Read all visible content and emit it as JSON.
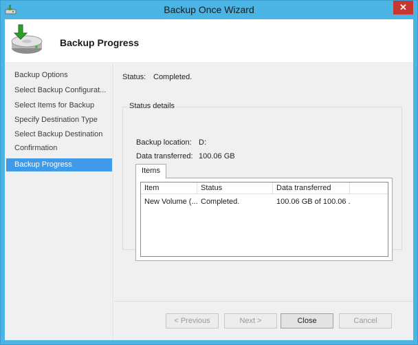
{
  "window": {
    "title": "Backup Once Wizard",
    "close_glyph": "✕"
  },
  "header": {
    "title": "Backup Progress"
  },
  "nav": {
    "items": [
      {
        "label": "Backup Options",
        "active": false
      },
      {
        "label": "Select Backup Configurat...",
        "active": false
      },
      {
        "label": "Select Items for Backup",
        "active": false
      },
      {
        "label": "Specify Destination Type",
        "active": false
      },
      {
        "label": "Select Backup Destination",
        "active": false
      },
      {
        "label": "Confirmation",
        "active": false
      },
      {
        "label": "Backup Progress",
        "active": true
      }
    ]
  },
  "status": {
    "label": "Status:",
    "value": "Completed."
  },
  "details": {
    "legend": "Status details",
    "location_label": "Backup location:",
    "location_value": "D:",
    "transferred_label": "Data transferred:",
    "transferred_value": "100.06 GB"
  },
  "items_tab": {
    "label": "Items",
    "columns": [
      "Item",
      "Status",
      "Data transferred"
    ],
    "rows": [
      [
        "New Volume (...",
        "Completed.",
        "100.06 GB of 100.06 ..."
      ]
    ]
  },
  "buttons": {
    "previous": "< Previous",
    "next": "Next >",
    "close": "Close",
    "cancel": "Cancel"
  },
  "colors": {
    "titlebar": "#4ab4e4",
    "selection": "#3f9ae8",
    "close_button": "#c7372f"
  },
  "icons": {
    "title": "backup-wizard-icon",
    "header": "backup-drive-icon"
  }
}
